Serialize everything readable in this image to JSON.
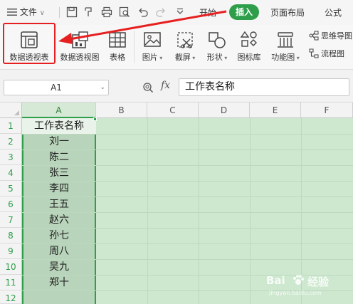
{
  "menubar": {
    "file_label": "文件",
    "tabs": [
      "开始",
      "插入",
      "页面布局",
      "公式"
    ],
    "active_tab": "插入"
  },
  "ribbon": {
    "buttons": [
      {
        "label": "数据透视表",
        "icon": "pivot-table-icon"
      },
      {
        "label": "数据透视图",
        "icon": "pivot-chart-icon"
      },
      {
        "label": "表格",
        "icon": "table-icon"
      },
      {
        "label": "图片",
        "icon": "picture-icon"
      },
      {
        "label": "截屏",
        "icon": "screenshot-icon"
      },
      {
        "label": "形状",
        "icon": "shape-icon"
      },
      {
        "label": "图标库",
        "icon": "icon-library-icon"
      },
      {
        "label": "功能图",
        "icon": "function-chart-icon"
      }
    ],
    "small_buttons": [
      {
        "label": "思维导图",
        "icon": "mindmap-icon"
      },
      {
        "label": "流程图",
        "icon": "flowchart-icon"
      }
    ],
    "accent_color": "#2e9e4a",
    "highlight_color": "#e62020"
  },
  "formula_bar": {
    "name_box": "A1",
    "fx_label": "fx",
    "content": "工作表名称"
  },
  "sheet": {
    "columns": [
      "A",
      "B",
      "C",
      "D",
      "E",
      "F"
    ],
    "rows": [
      "1",
      "2",
      "3",
      "4",
      "5",
      "6",
      "7",
      "8",
      "9",
      "10",
      "11",
      "12"
    ],
    "column_a": [
      "工作表名称",
      "刘一",
      "陈二",
      "张三",
      "李四",
      "王五",
      "赵六",
      "孙七",
      "周八",
      "吴九",
      "郑十",
      ""
    ],
    "selection_color": "#cde8cf"
  },
  "watermark": {
    "text": "Bai",
    "text2": "经验",
    "sub": "jingyan.baidu.com"
  }
}
